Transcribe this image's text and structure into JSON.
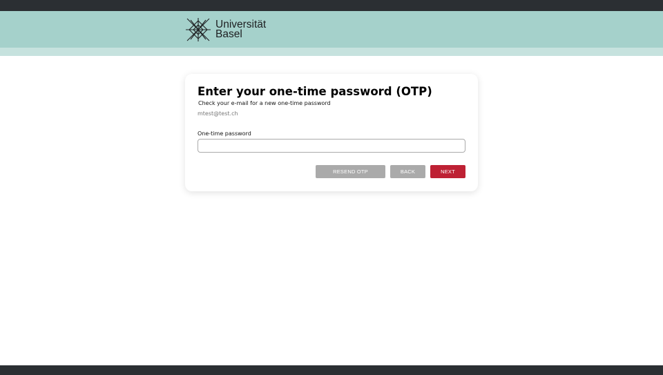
{
  "header": {
    "logo_line1": "Universität",
    "logo_line2": "Basel",
    "logo_icon": "university-star-mark-icon"
  },
  "card": {
    "title": "Enter your one-time password (OTP)",
    "subtitle": "Check your e-mail for a new one-time password",
    "email": "mtest@test.ch",
    "otp_label": "One-time password",
    "otp_value": "",
    "otp_placeholder": ""
  },
  "buttons": {
    "resend_label": "RESEND OTP",
    "back_label": "BACK",
    "next_label": "NEXT"
  },
  "colors": {
    "header_bg": "#a5d1cb",
    "header_strip": "#c6e2de",
    "dark_bar": "#2b2f33",
    "primary_button": "#be2134",
    "secondary_button": "#aaaaaa"
  }
}
